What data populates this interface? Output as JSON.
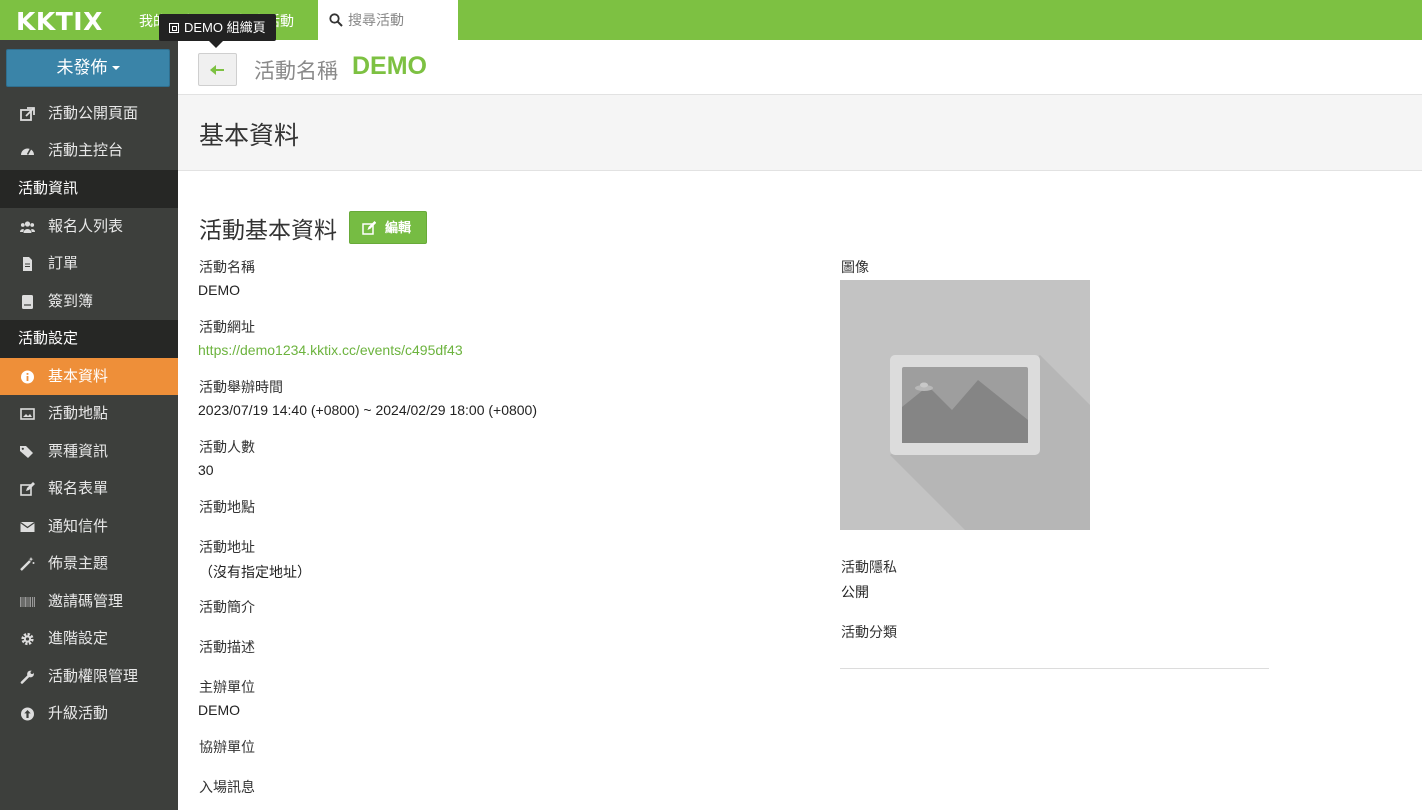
{
  "topbar": {
    "logo": "KKTIX",
    "nav_1": "我的票券",
    "nav_2": "探索活動",
    "search_placeholder": "搜尋活動"
  },
  "tooltip": {
    "text": "DEMO 組織頁"
  },
  "sidebar": {
    "publish_button": "未發佈",
    "items_top": [
      {
        "label": "活動公開頁面",
        "icon": "external-link-icon"
      },
      {
        "label": "活動主控台",
        "icon": "dashboard-icon"
      }
    ],
    "section_info": "活動資訊",
    "items_info": [
      {
        "label": "報名人列表",
        "icon": "users-icon"
      },
      {
        "label": "訂單",
        "icon": "file-icon"
      },
      {
        "label": "簽到簿",
        "icon": "book-icon"
      }
    ],
    "section_settings": "活動設定",
    "items_settings": [
      {
        "label": "基本資料",
        "icon": "info-circle-icon"
      },
      {
        "label": "活動地點",
        "icon": "image-icon"
      },
      {
        "label": "票種資訊",
        "icon": "tags-icon"
      },
      {
        "label": "報名表單",
        "icon": "edit-icon"
      },
      {
        "label": "通知信件",
        "icon": "envelope-icon"
      },
      {
        "label": "佈景主題",
        "icon": "magic-wand-icon"
      },
      {
        "label": "邀請碼管理",
        "icon": "barcode-icon"
      },
      {
        "label": "進階設定",
        "icon": "gear-icon"
      },
      {
        "label": "活動權限管理",
        "icon": "wrench-icon"
      },
      {
        "label": "升級活動",
        "icon": "arrow-up-circle-icon"
      }
    ]
  },
  "header": {
    "label": "活動名稱",
    "event_name": "DEMO",
    "page_title": "基本資料"
  },
  "main": {
    "section_title": "活動基本資料",
    "edit_button": "編輯",
    "fields": {
      "name_label": "活動名稱",
      "name_value": "DEMO",
      "url_label": "活動網址",
      "url_value": "https://demo1234.kktix.cc/events/c495df43",
      "time_label": "活動舉辦時間",
      "time_value": "2023/07/19 14:40 (+0800) ~ 2024/02/29 18:00 (+0800)",
      "attendees_label": "活動人數",
      "attendees_value": "30",
      "venue_label": "活動地點",
      "address_label": "活動地址",
      "address_value": "（沒有指定地址）",
      "summary_label": "活動簡介",
      "description_label": "活動描述",
      "organizer_label": "主辦單位",
      "organizer_value": "DEMO",
      "coorganizer_label": "協辦單位",
      "entry_label": "入場訊息",
      "image_label": "圖像",
      "privacy_label": "活動隱私",
      "privacy_value": "公開",
      "category_label": "活動分類"
    }
  },
  "colors": {
    "brand_green": "#7dc142",
    "sidebar_bg": "#3d3f3c",
    "sidebar_section_bg": "#262725",
    "active_orange": "#ee8f39",
    "publish_blue": "#3a84a8"
  }
}
